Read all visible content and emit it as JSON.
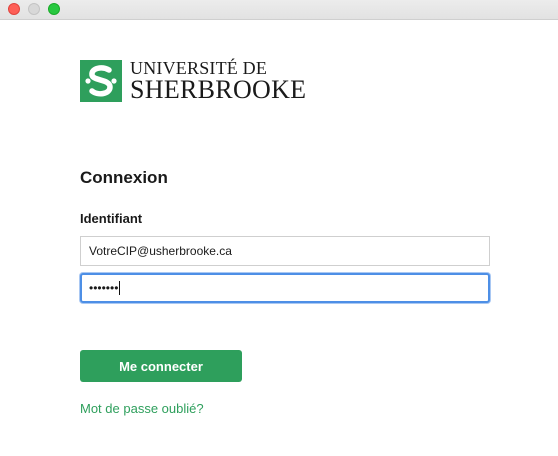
{
  "window": {
    "controls": [
      "close",
      "minimize",
      "maximize"
    ]
  },
  "logo": {
    "line1": "UNIVERSITÉ DE",
    "line2": "SHERBROOKE",
    "mark_color": "#2e9f5c"
  },
  "form": {
    "heading": "Connexion",
    "username_label": "Identifiant",
    "username_value": "VotreCIP@usherbrooke.ca",
    "password_mask": "•••••••",
    "submit_label": "Me connecter",
    "forgot_link": "Mot de passe oublié?"
  },
  "colors": {
    "accent": "#2e9f5c",
    "focus_ring": "#4d8fe6"
  }
}
